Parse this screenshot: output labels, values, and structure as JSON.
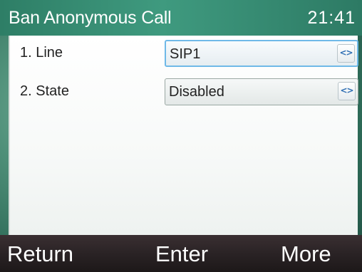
{
  "header": {
    "title": "Ban Anonymous Call",
    "time": "21:41"
  },
  "settings": [
    {
      "label": "1.  Line",
      "value": "SIP1"
    },
    {
      "label": "2.  State",
      "value": "Disabled"
    }
  ],
  "softkeys": {
    "return": "Return",
    "enter": "Enter",
    "more": "More"
  },
  "icons": {
    "selector": "left-right-arrows-icon",
    "selector_glyph": "<>"
  },
  "colors": {
    "title_bar": "#3f9a7f",
    "focus_border": "#6fb9e8",
    "softkey_bar": "#2a2325"
  }
}
